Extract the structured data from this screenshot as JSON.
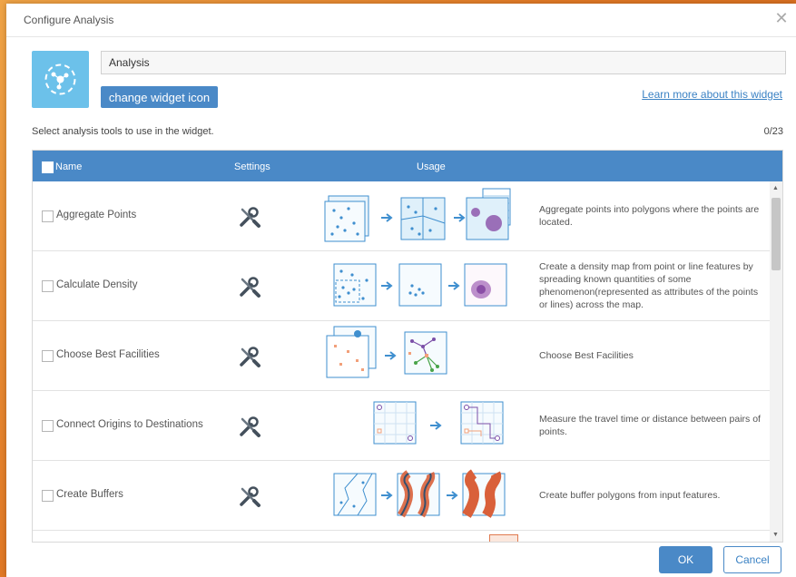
{
  "dialog": {
    "title": "Configure Analysis",
    "close_icon": "close-icon",
    "widget_name_value": "Analysis",
    "change_icon_label": "change widget icon",
    "learn_more_label": "Learn more about this widget",
    "select_text": "Select analysis tools to use in the widget.",
    "count": "0/23",
    "ok_label": "OK",
    "cancel_label": "Cancel",
    "accent_color": "#4a89c7"
  },
  "table": {
    "headers": {
      "name": "Name",
      "settings": "Settings",
      "usage": "Usage"
    },
    "rows": [
      {
        "name": "Aggregate Points",
        "settings_icon": "wrench-screwdriver-icon",
        "usage_icon": "aggregate-points-diagram",
        "description": "Aggregate points into polygons where the points are located."
      },
      {
        "name": "Calculate Density",
        "settings_icon": "wrench-screwdriver-icon",
        "usage_icon": "calculate-density-diagram",
        "description": "Create a density map from point or line features by spreading known quantities of some phenomenon(represented as attributes of the points or lines) across the map."
      },
      {
        "name": "Choose Best Facilities",
        "settings_icon": "wrench-screwdriver-icon",
        "usage_icon": "choose-best-facilities-diagram",
        "description": "Choose Best Facilities"
      },
      {
        "name": "Connect Origins to Destinations",
        "settings_icon": "wrench-screwdriver-icon",
        "usage_icon": "connect-origins-diagram",
        "description": "Measure the travel time or distance between pairs of points."
      },
      {
        "name": "Create Buffers",
        "settings_icon": "wrench-screwdriver-icon",
        "usage_icon": "create-buffers-diagram",
        "description": "Create buffer polygons from input features."
      }
    ]
  }
}
